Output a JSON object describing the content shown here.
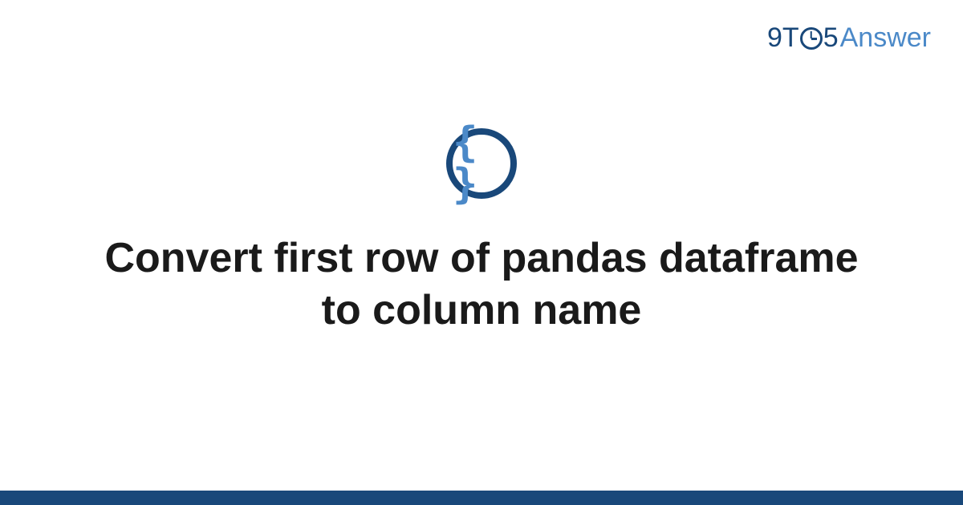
{
  "brand": {
    "part1": "9",
    "part2": "T",
    "part3": "5",
    "part4": "Answer"
  },
  "icon": {
    "glyph": "{ }",
    "name": "code-braces-icon"
  },
  "title": "Convert first row of pandas dataframe to column name",
  "colors": {
    "dark_blue": "#19487a",
    "light_blue": "#4b89c8"
  }
}
